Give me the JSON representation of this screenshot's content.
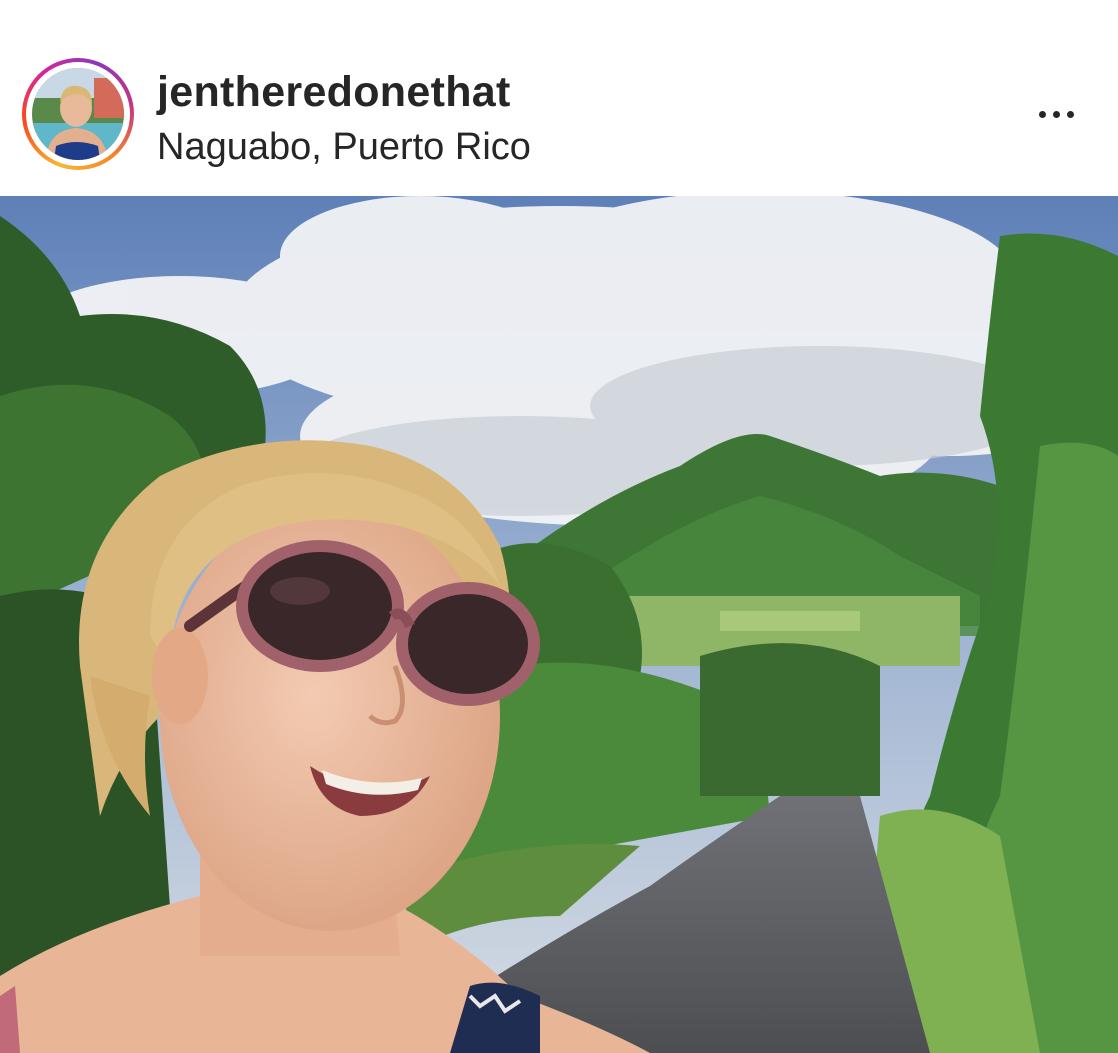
{
  "post": {
    "username": "jentheredonethat",
    "location": "Naguabo, Puerto Rico"
  },
  "icons": {
    "more": "more-horizontal-icon"
  },
  "colors": {
    "text": "#262626",
    "ring_start": "#f58529",
    "ring_end": "#8a3ab9",
    "sky": "#6d8fc2",
    "mountain": "#3f7a3a",
    "road": "#5f6166"
  }
}
